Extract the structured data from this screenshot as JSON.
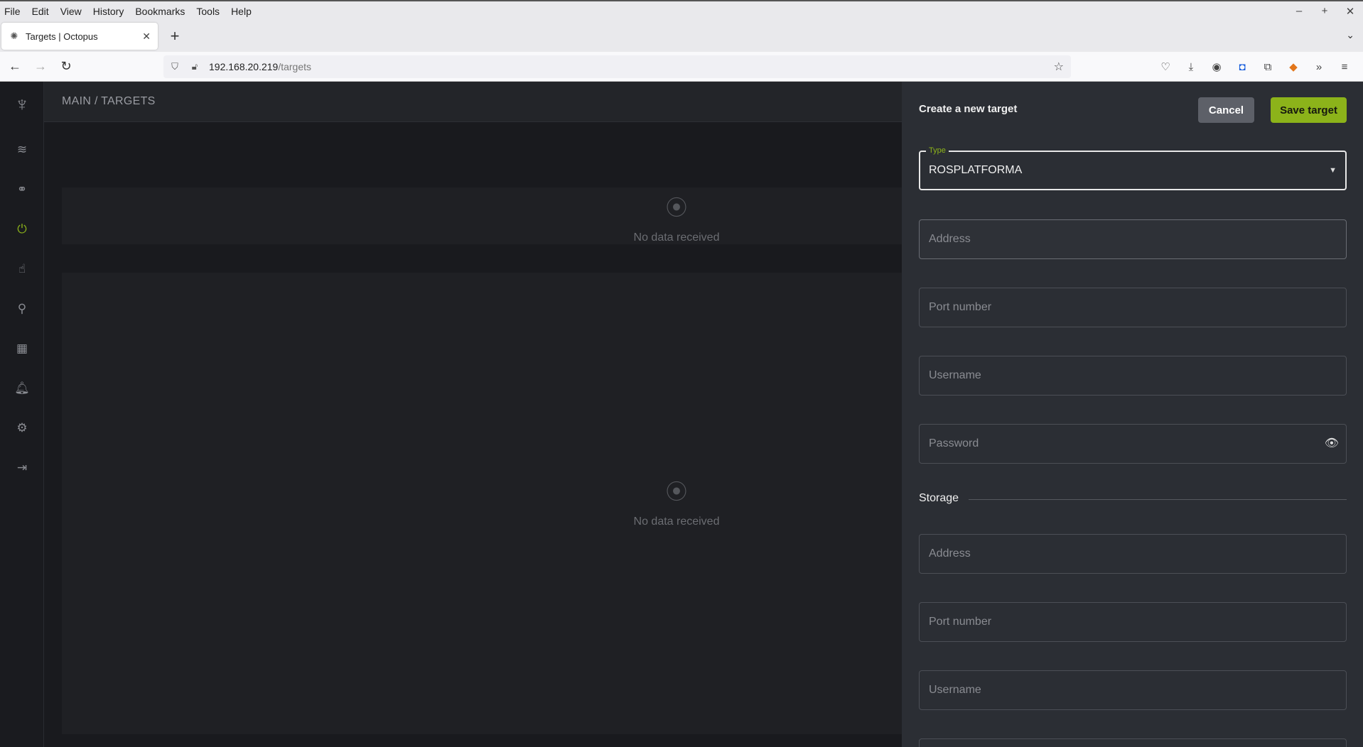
{
  "browser": {
    "menu": [
      "File",
      "Edit",
      "View",
      "History",
      "Bookmarks",
      "Tools",
      "Help"
    ],
    "window_controls": [
      "–",
      "+",
      "✕"
    ],
    "tab": {
      "title": "Targets | Octopus"
    },
    "url": {
      "host": "192.168.20.219",
      "path": "/targets"
    }
  },
  "app": {
    "breadcrumb": "MAIN  /  TARGETS",
    "sidebar_icons": [
      "octopus-logo",
      "layers-icon",
      "nodes-icon",
      "power-icon",
      "hand-icon",
      "search-icon",
      "dashboard-icon",
      "bell-icon",
      "gear-icon",
      "logout-icon"
    ],
    "active_sidebar": "power-icon",
    "panels": [
      {
        "message": "No data received"
      },
      {
        "message": "No data received"
      }
    ]
  },
  "drawer": {
    "title": "Create a new target",
    "cancel_label": "Cancel",
    "save_label": "Save target",
    "type_field": {
      "label": "Type",
      "value": "ROSPLATFORMA"
    },
    "fields": {
      "address": "Address",
      "port": "Port number",
      "username": "Username",
      "password": "Password"
    },
    "storage": {
      "section_label": "Storage",
      "address": "Address",
      "port": "Port number",
      "username": "Username"
    }
  },
  "colors": {
    "accent": "#8cb31a",
    "drawer_bg": "#2b2e34",
    "app_bg": "#1f2125"
  }
}
